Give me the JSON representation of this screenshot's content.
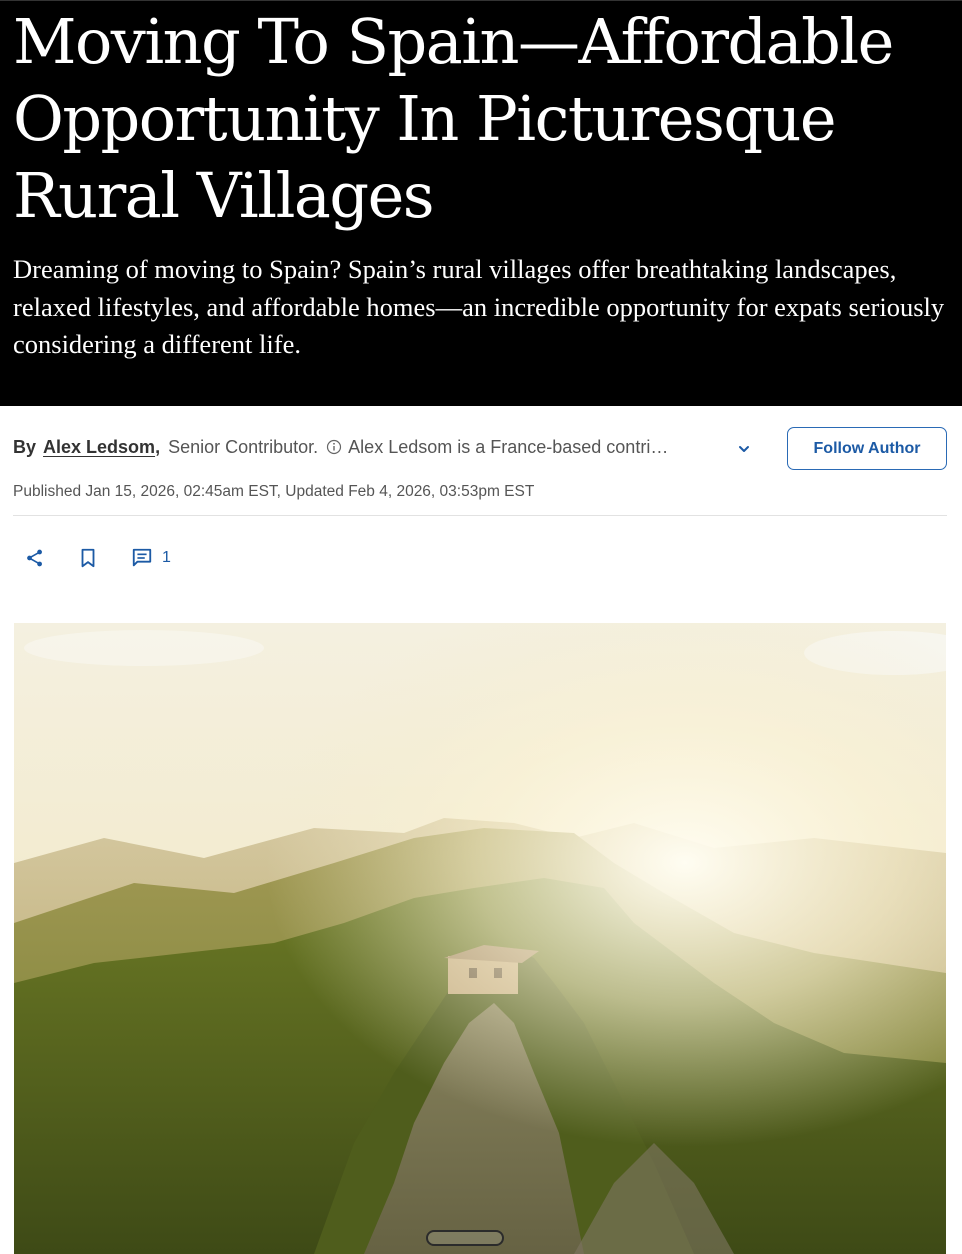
{
  "article": {
    "headline": "Moving To Spain—Affordable Opportunity In Picturesque Rural Villages",
    "dek": "Dreaming of moving to Spain? Spain’s rural villages offer breathtaking landscapes, relaxed lifestyles, and affordable homes—an incredible opportunity for expats seriously considering a different life."
  },
  "byline": {
    "prefix": "By",
    "author": "Alex Ledsom",
    "separator": ",",
    "role": "Senior Contributor.",
    "bio": "Alex Ledsom is a France-based contri…",
    "follow_label": "Follow Author",
    "info_icon": "info-circle-icon",
    "expand_icon": "chevron-down-icon"
  },
  "dateline": "Published Jan 15, 2026, 02:45am EST, Updated Feb 4, 2026, 03:53pm EST",
  "actions": {
    "share_icon": "share-icon",
    "bookmark_icon": "bookmark-icon",
    "comment_icon": "comment-icon",
    "comment_count": "1"
  },
  "colors": {
    "hero_background": "#000000",
    "hero_text": "#ffffff",
    "accent_blue": "#1c5aa5",
    "body_text": "#555555"
  }
}
